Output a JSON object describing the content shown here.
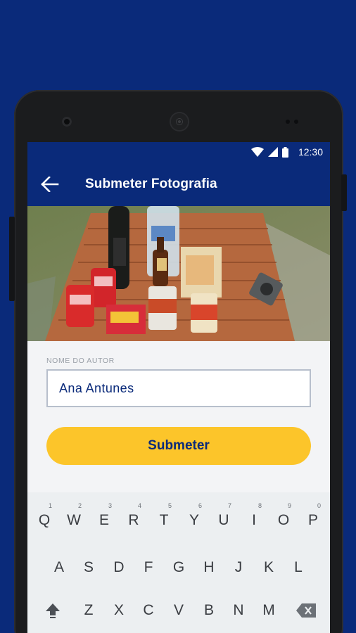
{
  "status_bar": {
    "time": "12:30",
    "icons": [
      "wifi-icon",
      "signal-icon",
      "battery-icon"
    ]
  },
  "app_bar": {
    "title": "Submeter Fotografia",
    "back_icon": "arrow-left-icon"
  },
  "form": {
    "author_label": "NOME DO AUTOR",
    "author_value": "Ana Antunes",
    "submit_label": "Submeter"
  },
  "keyboard": {
    "row1": [
      {
        "k": "Q",
        "h": "1"
      },
      {
        "k": "W",
        "h": "2"
      },
      {
        "k": "E",
        "h": "3"
      },
      {
        "k": "R",
        "h": "4"
      },
      {
        "k": "T",
        "h": "5"
      },
      {
        "k": "Y",
        "h": "6"
      },
      {
        "k": "U",
        "h": "7"
      },
      {
        "k": "I",
        "h": "8"
      },
      {
        "k": "O",
        "h": "9"
      },
      {
        "k": "P",
        "h": "0"
      }
    ],
    "row2": [
      "A",
      "S",
      "D",
      "F",
      "G",
      "H",
      "J",
      "K",
      "L"
    ],
    "row3": [
      "Z",
      "X",
      "C",
      "V",
      "B",
      "N",
      "M"
    ],
    "shift_icon": "shift-icon",
    "backspace_icon": "backspace-icon"
  },
  "colors": {
    "brand_blue": "#0a2a7a",
    "accent_yellow": "#fcc52a"
  }
}
